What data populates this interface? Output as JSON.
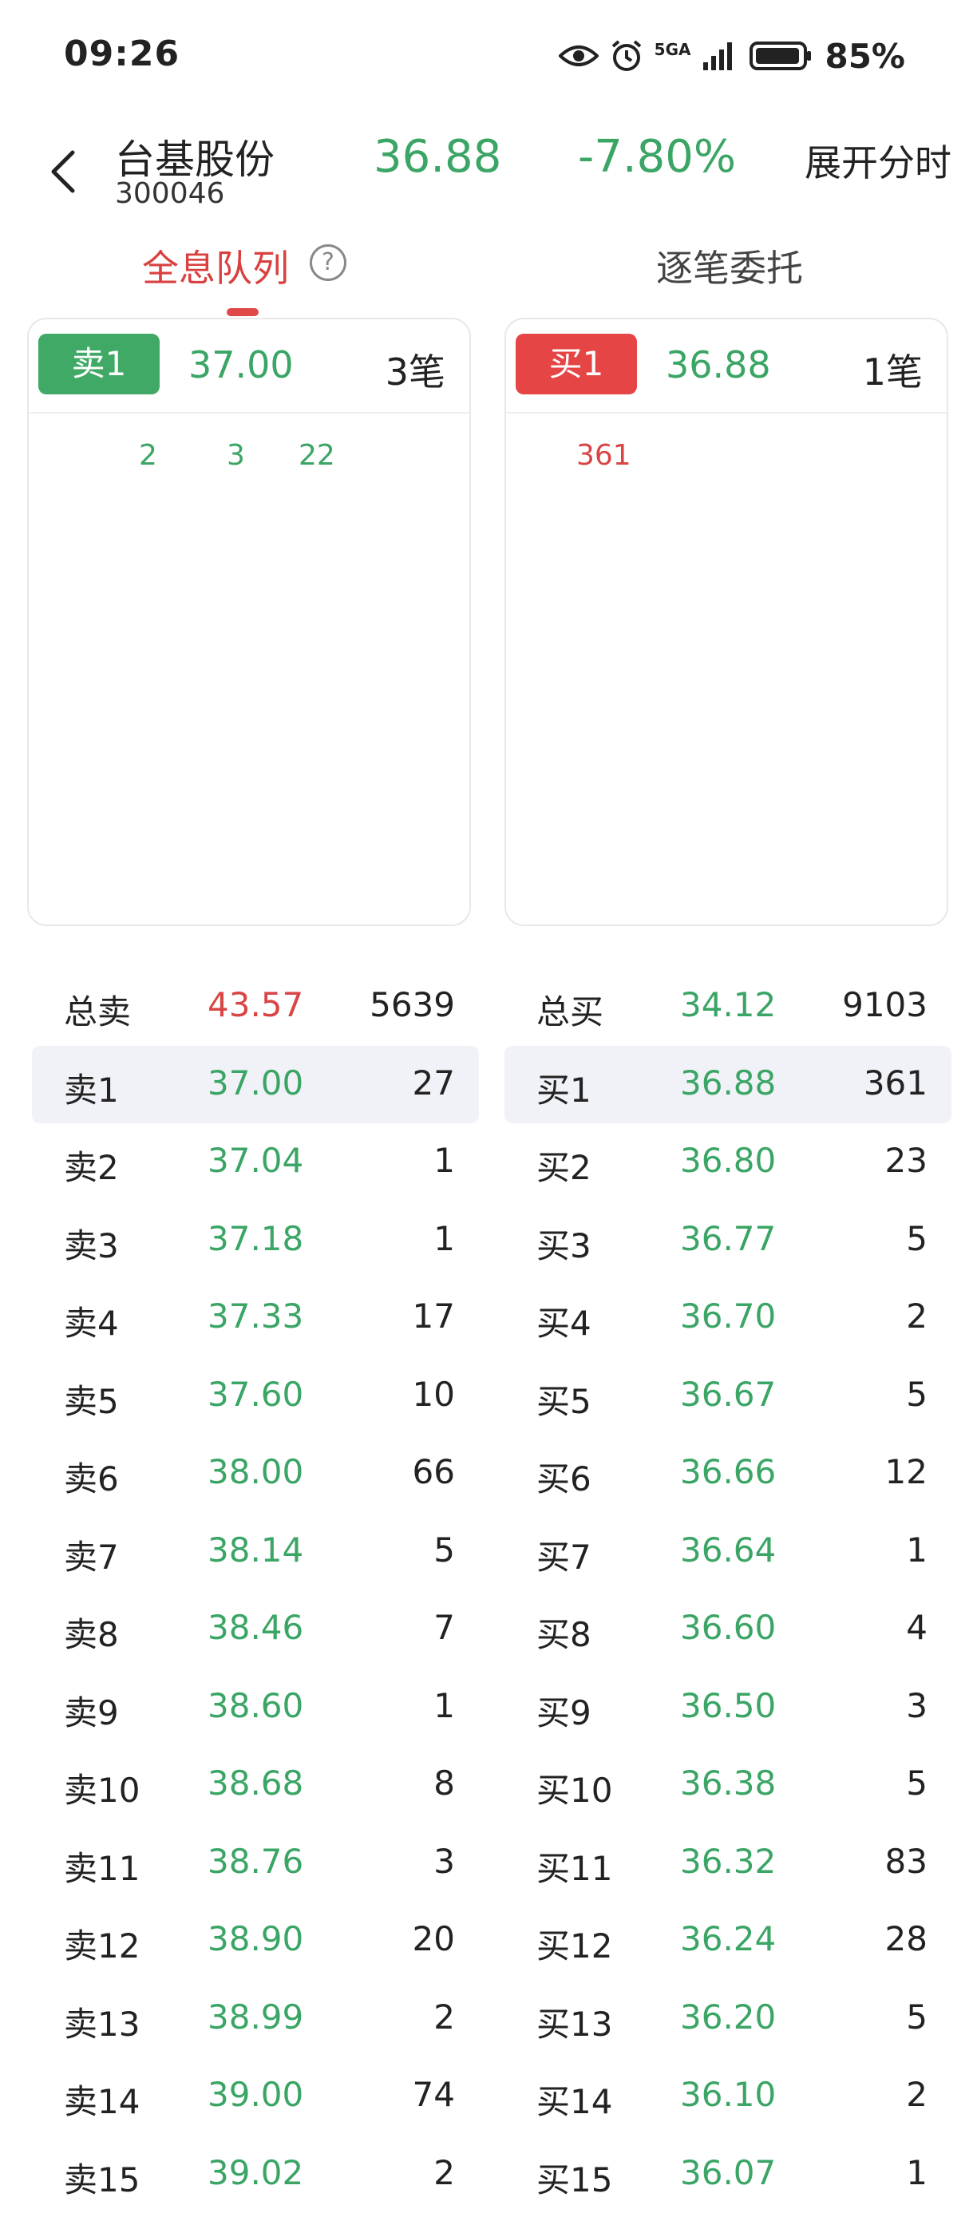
{
  "status": {
    "time": "09:26",
    "battery": "85%",
    "network": "5GA"
  },
  "header": {
    "stock_name": "台基股份",
    "stock_code": "300046",
    "price": "36.88",
    "change": "-7.80%",
    "expand_label": "展开分时"
  },
  "tabs": {
    "active": "全息队列",
    "inactive": "逐笔委托"
  },
  "queue_panels": {
    "sell": {
      "badge": "卖1",
      "price": "37.00",
      "count": "3笔",
      "orders": [
        "2",
        "3",
        "22"
      ]
    },
    "buy": {
      "badge": "买1",
      "price": "36.88",
      "count": "1笔",
      "orders": [
        "361"
      ]
    }
  },
  "depth": {
    "sell": [
      {
        "label": "总卖",
        "price": "43.57",
        "volume": "5639"
      },
      {
        "label": "卖1",
        "price": "37.00",
        "volume": "27"
      },
      {
        "label": "卖2",
        "price": "37.04",
        "volume": "1"
      },
      {
        "label": "卖3",
        "price": "37.18",
        "volume": "1"
      },
      {
        "label": "卖4",
        "price": "37.33",
        "volume": "17"
      },
      {
        "label": "卖5",
        "price": "37.60",
        "volume": "10"
      },
      {
        "label": "卖6",
        "price": "38.00",
        "volume": "66"
      },
      {
        "label": "卖7",
        "price": "38.14",
        "volume": "5"
      },
      {
        "label": "卖8",
        "price": "38.46",
        "volume": "7"
      },
      {
        "label": "卖9",
        "price": "38.60",
        "volume": "1"
      },
      {
        "label": "卖10",
        "price": "38.68",
        "volume": "8"
      },
      {
        "label": "卖11",
        "price": "38.76",
        "volume": "3"
      },
      {
        "label": "卖12",
        "price": "38.90",
        "volume": "20"
      },
      {
        "label": "卖13",
        "price": "38.99",
        "volume": "2"
      },
      {
        "label": "卖14",
        "price": "39.00",
        "volume": "74"
      },
      {
        "label": "卖15",
        "price": "39.02",
        "volume": "2"
      }
    ],
    "buy": [
      {
        "label": "总买",
        "price": "34.12",
        "volume": "9103"
      },
      {
        "label": "买1",
        "price": "36.88",
        "volume": "361"
      },
      {
        "label": "买2",
        "price": "36.80",
        "volume": "23"
      },
      {
        "label": "买3",
        "price": "36.77",
        "volume": "5"
      },
      {
        "label": "买4",
        "price": "36.70",
        "volume": "2"
      },
      {
        "label": "买5",
        "price": "36.67",
        "volume": "5"
      },
      {
        "label": "买6",
        "price": "36.66",
        "volume": "12"
      },
      {
        "label": "买7",
        "price": "36.64",
        "volume": "1"
      },
      {
        "label": "买8",
        "price": "36.60",
        "volume": "4"
      },
      {
        "label": "买9",
        "price": "36.50",
        "volume": "3"
      },
      {
        "label": "买10",
        "price": "36.38",
        "volume": "5"
      },
      {
        "label": "买11",
        "price": "36.32",
        "volume": "83"
      },
      {
        "label": "买12",
        "price": "36.24",
        "volume": "28"
      },
      {
        "label": "买13",
        "price": "36.20",
        "volume": "5"
      },
      {
        "label": "买14",
        "price": "36.10",
        "volume": "2"
      },
      {
        "label": "买15",
        "price": "36.07",
        "volume": "1"
      }
    ]
  },
  "colors": {
    "up": "#d94545",
    "down": "#3aa565",
    "highlight": "#f1f2f7"
  }
}
